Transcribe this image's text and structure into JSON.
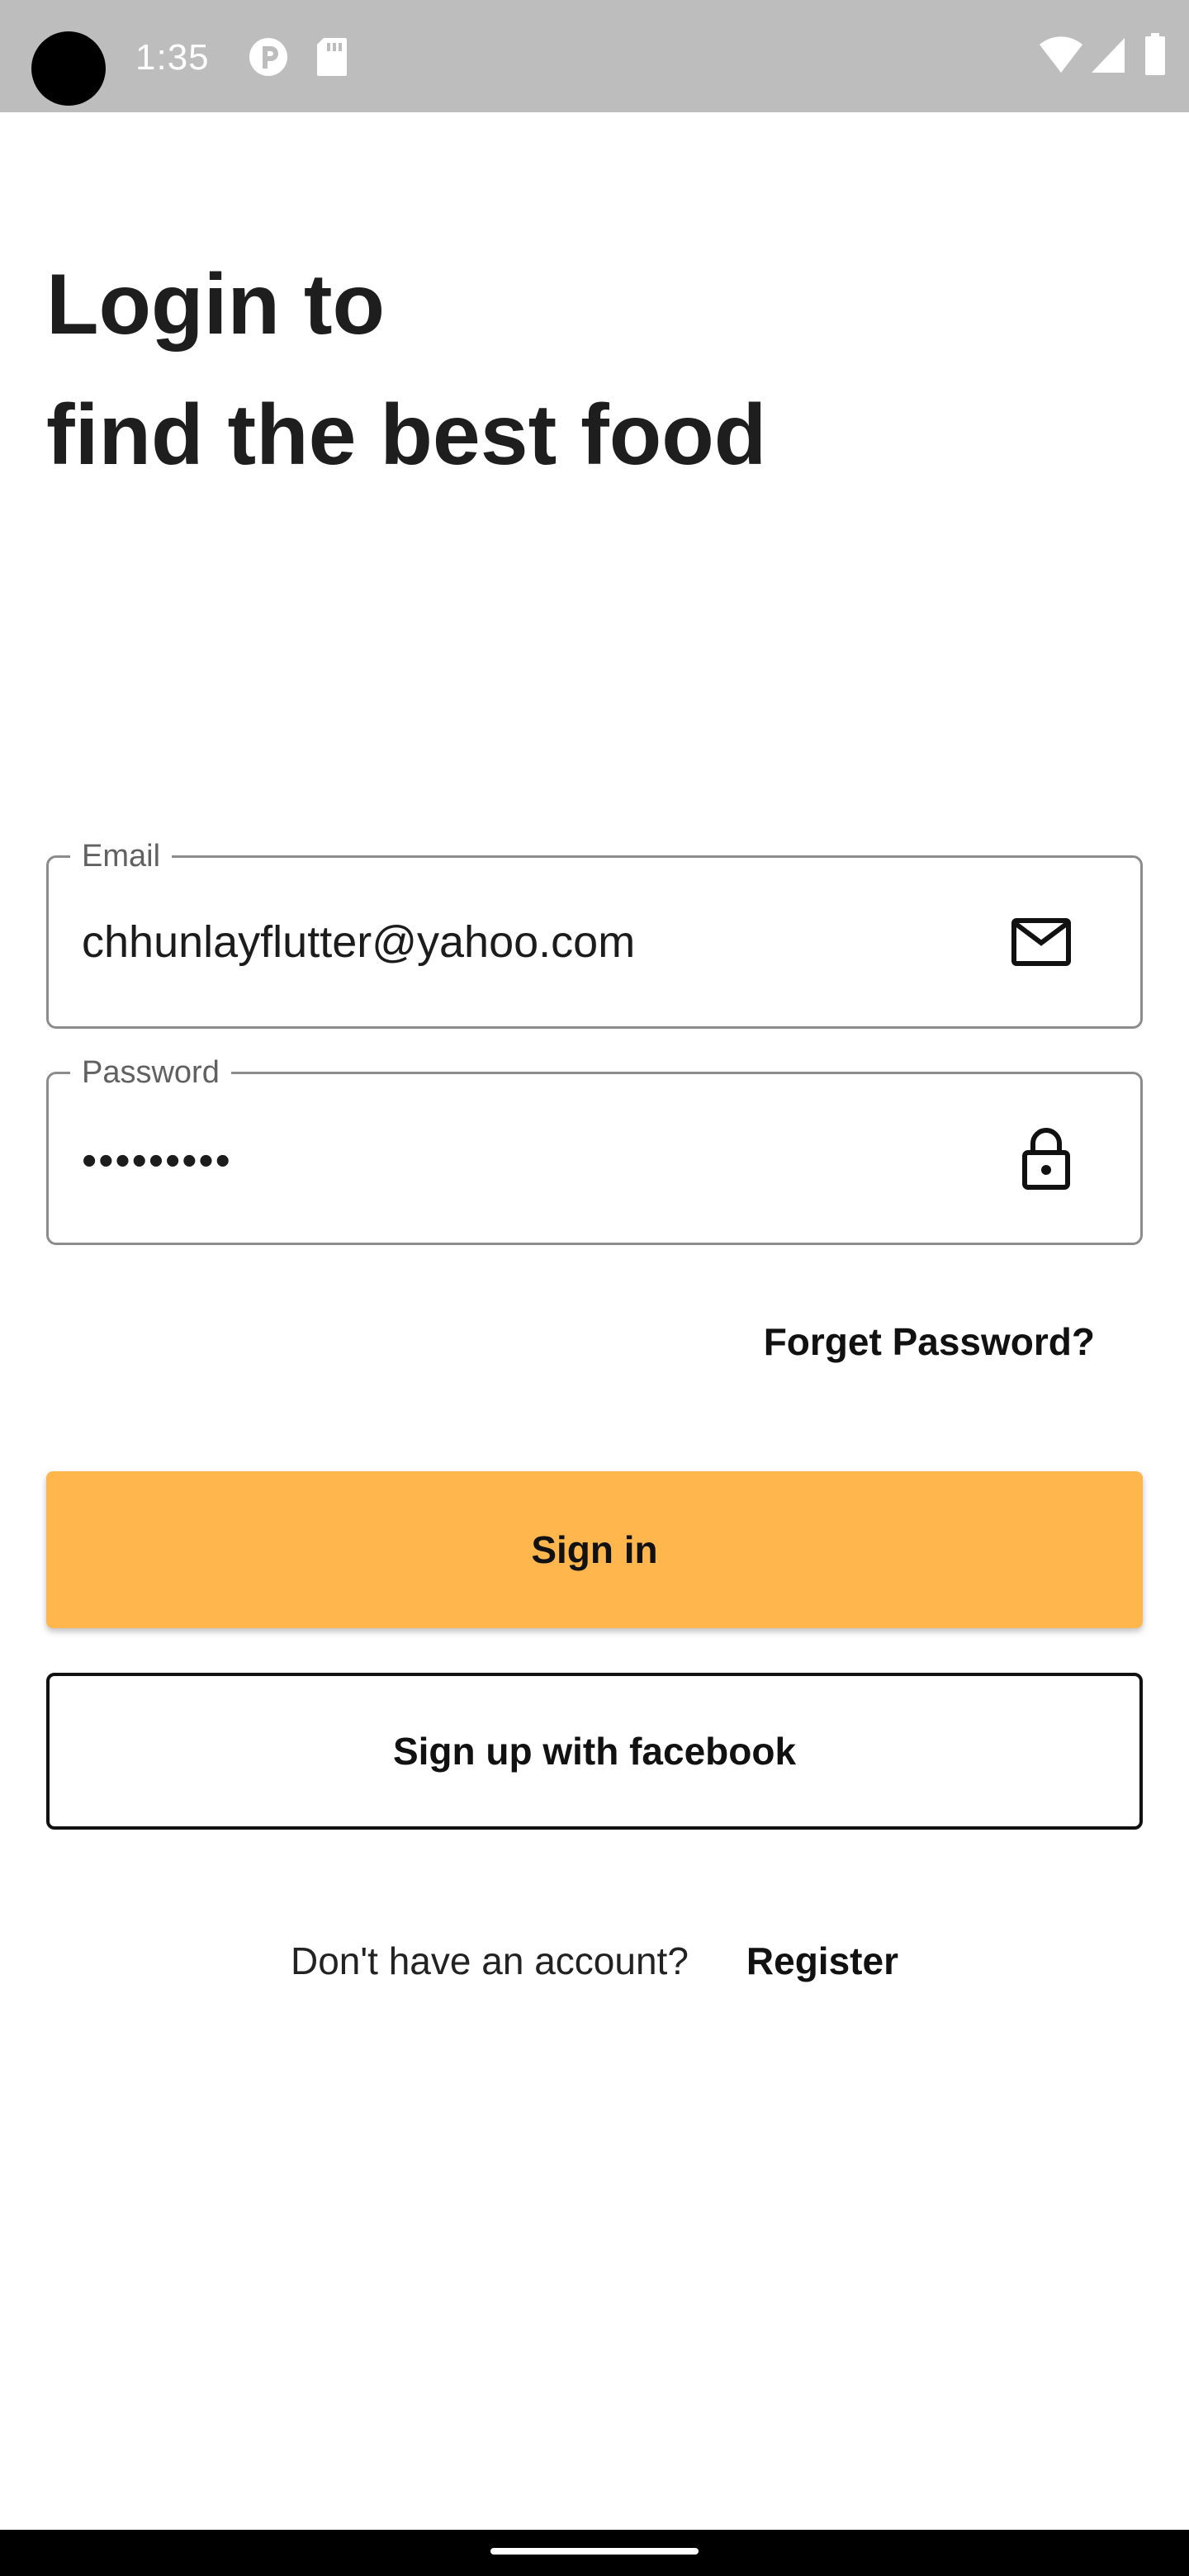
{
  "status_bar": {
    "time": "1:35",
    "icons": [
      "camera-cutout",
      "pocket-casts-icon",
      "sd-card-icon",
      "wifi-icon",
      "signal-icon",
      "battery-icon"
    ]
  },
  "heading": {
    "line1": "Login to",
    "line2": "find the best food"
  },
  "email_field": {
    "label": "Email",
    "value": "chhunlayflutter@yahoo.com",
    "icon": "mail-icon"
  },
  "password_field": {
    "label": "Password",
    "value": "•••••••••",
    "icon": "lock-icon"
  },
  "forgot_password": "Forget Password?",
  "sign_in_button": "Sign in",
  "facebook_button": "Sign up with facebook",
  "register": {
    "prompt": "Don't have an account?",
    "link": "Register"
  },
  "colors": {
    "primary": "#ffb74d",
    "status_bar": "#bdbdbd",
    "text": "#1c1c1c"
  }
}
